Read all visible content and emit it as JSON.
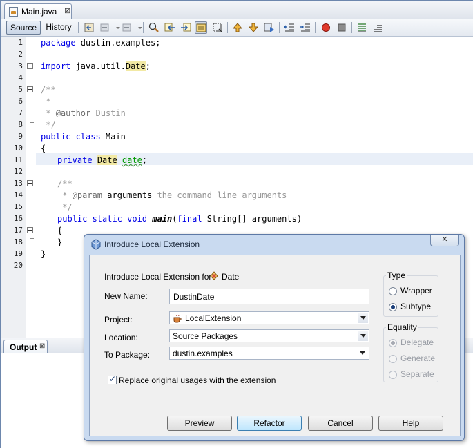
{
  "editor_tab": {
    "file_name": "Main.java",
    "close_glyph": "⊠"
  },
  "toolbar": {
    "source_label": "Source",
    "history_label": "History"
  },
  "code": {
    "line_numbers": [
      "1",
      "2",
      "3",
      "4",
      "5",
      "6",
      "7",
      "8",
      "9",
      "10",
      "11",
      "12",
      "13",
      "14",
      "15",
      "16",
      "17",
      "18",
      "19",
      "20"
    ],
    "l1": {
      "kw": "package",
      "rest": " dustin.examples;"
    },
    "l3": {
      "kw": "import",
      "pre": " java.util.",
      "type": "Date",
      "post": ";"
    },
    "l5": "/**",
    "l6": " *",
    "l7": {
      "pre": " * ",
      "tag": "@author",
      "post": " Dustin"
    },
    "l8": " */",
    "l9": {
      "kw": "public class",
      "rest": " Main"
    },
    "l10": "{",
    "l11": {
      "kw": "private",
      "type": "Date",
      "field": "date",
      "post": ";"
    },
    "l13": "/**",
    "l14": {
      "pre": " * ",
      "tag": "@param",
      "name": " arguments",
      "post": " the command line arguments"
    },
    "l15": " */",
    "l16": {
      "kw": "public static void",
      "method": "main",
      "open": "(",
      "kw2": "final",
      "rest": " String[] arguments)"
    },
    "l17": "{",
    "l18": "}",
    "l19": "}"
  },
  "output": {
    "tab_label": "Output",
    "close_glyph": "⊠"
  },
  "dialog": {
    "title": "Introduce Local Extension",
    "close_glyph": "✕",
    "intro_label": "Introduce Local Extension for",
    "intro_class": "Date",
    "new_name_label": "New Name:",
    "new_name_value": "DustinDate",
    "project_label": "Project:",
    "project_value": "LocalExtension",
    "location_label": "Location:",
    "location_value": "Source Packages",
    "package_label": "To Package:",
    "package_value": "dustin.examples",
    "replace_label": "Replace original usages with the extension",
    "replace_checked": true,
    "type_group": {
      "title": "Type",
      "options": [
        "Wrapper",
        "Subtype"
      ],
      "selected": "Subtype"
    },
    "equality_group": {
      "title": "Equality",
      "options": [
        "Delegate",
        "Generate",
        "Separate"
      ],
      "selected": "Delegate",
      "enabled": false
    },
    "buttons": {
      "preview": "Preview",
      "refactor": "Refactor",
      "cancel": "Cancel",
      "help": "Help"
    }
  },
  "colors": {
    "keyword": "#0000e6",
    "comment": "#969696",
    "highlight": "#f2e9a4",
    "field": "#009900",
    "dialog_frame": "#c9daf0"
  }
}
